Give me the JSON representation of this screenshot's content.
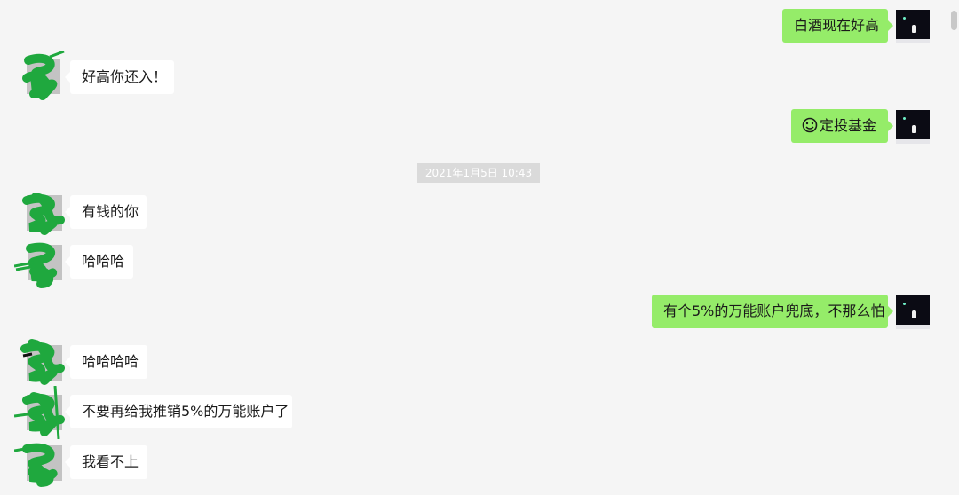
{
  "timestamp": "2021年1月5日 10:43",
  "messages": [
    {
      "text": "白酒现在好高"
    },
    {
      "text": "好高你还入！"
    },
    {
      "text": "定投基金",
      "icon": "smiley-emoji-icon"
    },
    {
      "text": "有钱的你"
    },
    {
      "text": "哈哈哈"
    },
    {
      "text": "有个5%的万能账户兜底，不那么怕"
    },
    {
      "text": "哈哈哈哈"
    },
    {
      "text": "不要再给我推销5%的万能账户了"
    },
    {
      "text": "我看不上"
    }
  ],
  "colors": {
    "background": "#f5f5f5",
    "outgoing_bubble": "#95ec69",
    "incoming_bubble": "#ffffff",
    "avatar_scribble": "#1fa83e",
    "timestamp_bg": "#dadada"
  }
}
